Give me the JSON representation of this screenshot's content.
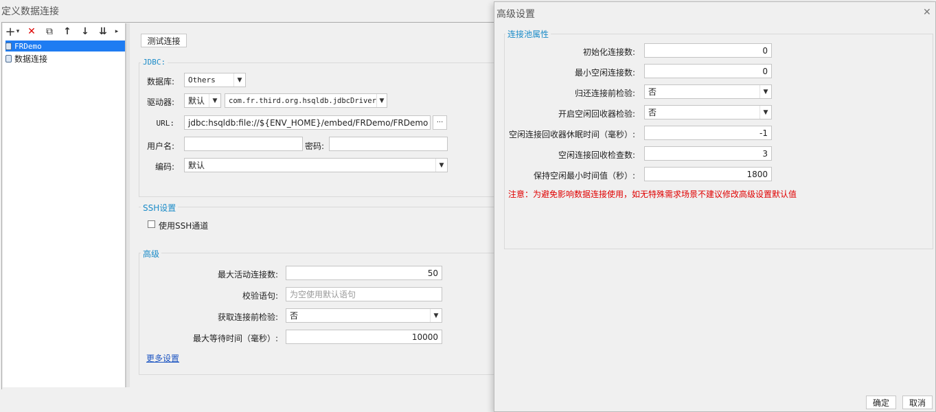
{
  "window": {
    "title": "定义数据连接"
  },
  "toolbar": {
    "add": "+",
    "add_dropdown": "▾",
    "delete": "✕",
    "copy": "⧉",
    "up": "↑",
    "down": "↓",
    "bottom": "⇊",
    "more": "▸"
  },
  "sidebar": {
    "items": [
      {
        "label": "FRDemo",
        "selected": true
      },
      {
        "label": "数据连接",
        "selected": false
      }
    ]
  },
  "main": {
    "test_button": "测试连接",
    "jdbc": {
      "title": "JDBC:",
      "database_label": "数据库:",
      "database_value": "Others",
      "driver_label": "驱动器:",
      "driver_mode": "默认",
      "driver_value": "com.fr.third.org.hsqldb.jdbcDriver",
      "url_label": "URL:",
      "url_value": "jdbc:hsqldb:file://${ENV_HOME}/embed/FRDemo/FRDemo",
      "url_button": "···",
      "username_label": "用户名:",
      "username_value": "",
      "password_label": "密码:",
      "password_value": "",
      "encoding_label": "编码:",
      "encoding_value": "默认"
    },
    "ssh": {
      "title": "SSH设置",
      "use_ssh_label": "使用SSH通道",
      "use_ssh_checked": false
    },
    "advanced": {
      "title": "高级",
      "max_active_label": "最大活动连接数:",
      "max_active_value": "50",
      "validation_label": "校验语句:",
      "validation_placeholder": "为空使用默认语句",
      "test_before_label": "获取连接前检验:",
      "test_before_value": "否",
      "max_wait_label": "最大等待时间（毫秒）:",
      "max_wait_value": "10000",
      "more_link": "更多设置"
    }
  },
  "dialog": {
    "title": "高级设置",
    "close": "✕",
    "section_title": "连接池属性",
    "rows": [
      {
        "label": "初始化连接数:",
        "value": "0",
        "kind": "number"
      },
      {
        "label": "最小空闲连接数:",
        "value": "0",
        "kind": "number"
      },
      {
        "label": "归还连接前检验:",
        "value": "否",
        "kind": "select"
      },
      {
        "label": "开启空闲回收器检验:",
        "value": "否",
        "kind": "select"
      },
      {
        "label": "空闲连接回收器休眠时间（毫秒）:",
        "value": "-1",
        "kind": "number"
      },
      {
        "label": "空闲连接回收检查数:",
        "value": "3",
        "kind": "number"
      },
      {
        "label": "保持空闲最小时间值（秒）:",
        "value": "1800",
        "kind": "number"
      }
    ],
    "warning": "注意：为避免影响数据连接使用，如无特殊需求场景不建议修改高级设置默认值",
    "ok_button": "确定",
    "cancel_button": "取消"
  },
  "colors": {
    "accent": "#1a8bc8",
    "selection": "#1e7cf2",
    "warning": "#e00000",
    "link": "#1d55c2"
  }
}
